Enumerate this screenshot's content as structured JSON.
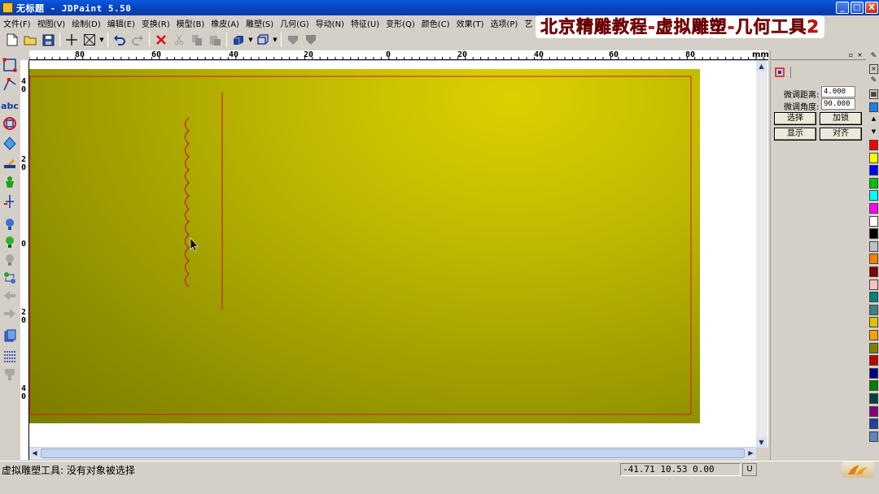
{
  "window": {
    "title": "无标题 - JDPaint 5.50",
    "minimize_label": "_",
    "maximize_label": "□",
    "close_label": "X"
  },
  "menu": [
    "文件(F)",
    "视图(V)",
    "绘制(D)",
    "编辑(E)",
    "变换(R)",
    "模型(B)",
    "橡皮(A)",
    "雕塑(S)",
    "几何(G)",
    "导动(N)",
    "特征(U)",
    "变形(Q)",
    "颜色(C)",
    "效果(T)",
    "选项(P)",
    "艺"
  ],
  "watermark": "北京精雕教程-虚拟雕塑-几何工具2",
  "ruler": {
    "unit": "mm",
    "top_labels": [
      "80",
      "60",
      "40",
      "20",
      "0",
      "20",
      "40",
      "60",
      "80"
    ],
    "left_labels": [
      "40",
      "20",
      "0",
      "20",
      "40"
    ]
  },
  "panel": {
    "distance_label": "微调距离:",
    "distance_value": "4.000",
    "angle_label": "微调角度:",
    "angle_value": "90.000",
    "buttons": [
      "选择",
      "加锁",
      "显示",
      "对齐"
    ]
  },
  "palette_colors": [
    "#ff0000",
    "#ffff00",
    "#0000ff",
    "#00c000",
    "#00ffff",
    "#ff00ff",
    "#ffffff",
    "#000000",
    "#c0c0c0",
    "#ff8000",
    "#800000",
    "#ffc0c0",
    "#008080",
    "#408080",
    "#e0c000",
    "#ffa000",
    "#808000",
    "#c00000",
    "#000080",
    "#008000",
    "#004040",
    "#800080",
    "#2040a0",
    "#6080c0"
  ],
  "status": {
    "message": "虚拟雕塑工具: 没有对象被选择",
    "coords": "-41.71 10.53 0.00",
    "mode": "U"
  }
}
